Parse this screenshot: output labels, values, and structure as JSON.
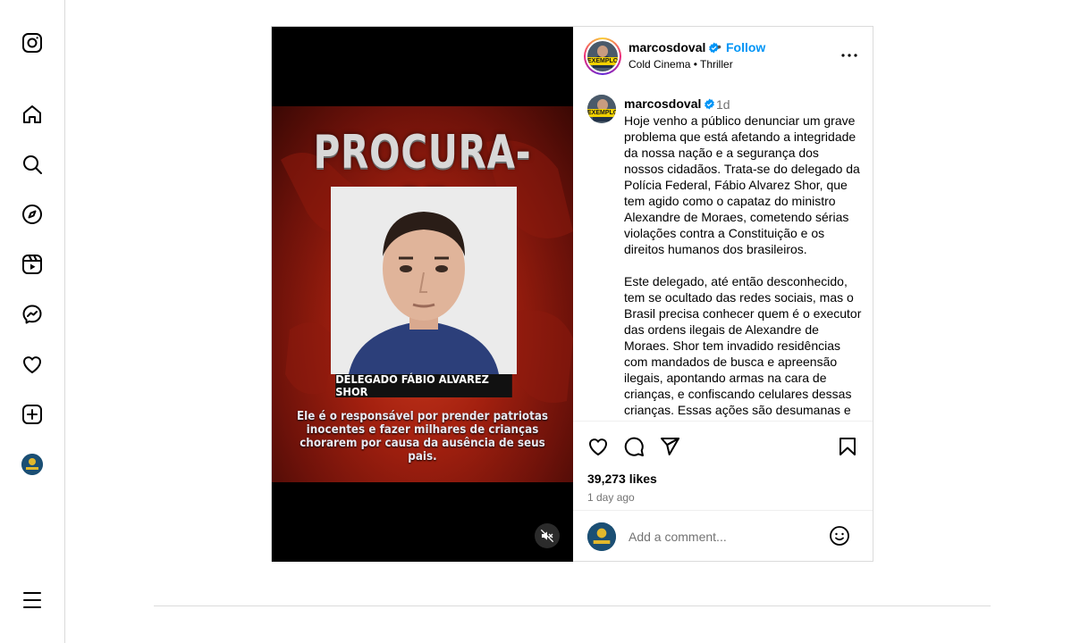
{
  "sidebar": {
    "items": [
      {
        "name": "instagram-logo-icon"
      },
      {
        "name": "home-icon"
      },
      {
        "name": "search-icon"
      },
      {
        "name": "explore-icon"
      },
      {
        "name": "reels-icon"
      },
      {
        "name": "messenger-icon"
      },
      {
        "name": "notifications-heart-icon"
      },
      {
        "name": "create-icon"
      },
      {
        "name": "profile-avatar"
      },
      {
        "name": "menu-icon"
      }
    ]
  },
  "media": {
    "title": "PROCURA-SE",
    "photo_caption": "DELEGADO FÁBIO ALVAREZ SHOR",
    "subtitle": "Ele é o responsável por prender patriotas inocentes e fazer milhares de crianças chorarem por causa da ausência de seus pais."
  },
  "header": {
    "username": "marcosdoval",
    "separator": "•",
    "follow_label": "Follow",
    "audio": "Cold Cinema • Thriller"
  },
  "avatar_band_text": "EXEMPLO",
  "caption": {
    "username": "marcosdoval",
    "time": "1d",
    "text": "Hoje venho a público denunciar um grave problema que está afetando a integridade da nossa nação e a segurança dos nossos cidadãos. Trata-se do delegado da Polícia Federal, Fábio Alvarez Shor, que tem agido como o capataz do ministro Alexandre de Moraes, cometendo sérias violações contra a Constituição e os direitos humanos dos brasileiros.\n\nEste delegado, até então desconhecido, tem se ocultado das redes sociais, mas o Brasil precisa conhecer quem é o executor das ordens ilegais de Alexandre de Moraes. Shor tem invadido residências com mandados de busca e apreensão ilegais, apontando armas na cara de crianças, e confiscando celulares dessas crianças. Essas ações são desumanas e inaceitáveis, e"
  },
  "stats": {
    "likes": "39,273 likes",
    "posted": "1 day ago"
  },
  "comment": {
    "placeholder": "Add a comment..."
  },
  "colors": {
    "accent": "#0095f6",
    "border": "#dbdbdb",
    "muted": "#737373",
    "verified": "#0095f6"
  }
}
